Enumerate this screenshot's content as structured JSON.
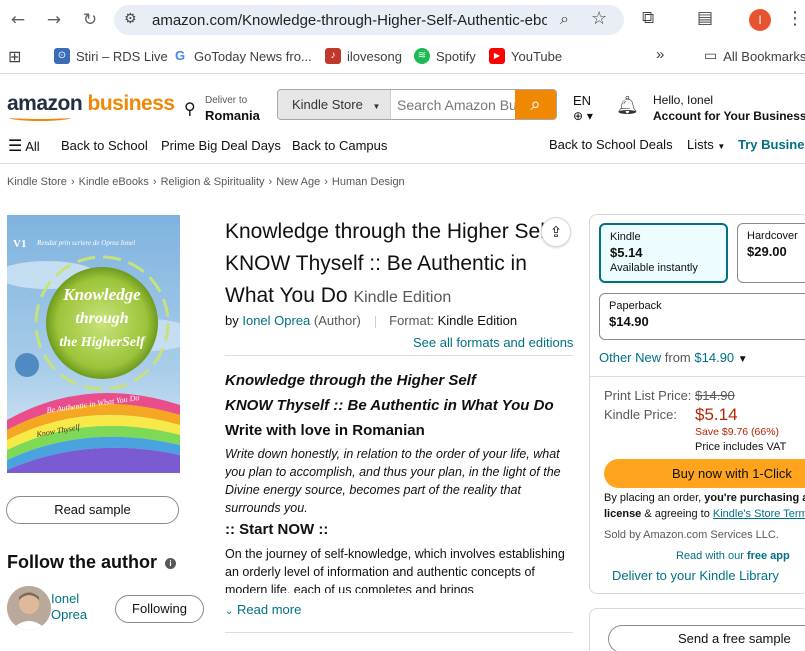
{
  "browser": {
    "url": "amazon.com/Knowledge-through-Higher-Self-Authentic-ebo...",
    "profile_initial": "I",
    "bookmarks": [
      {
        "label": "Stiri – RDS Live",
        "color": "#3b6cb7"
      },
      {
        "label": "GoToday News fro...",
        "color": "#4285f4"
      },
      {
        "label": "ilovesong",
        "color": "#c0392b"
      },
      {
        "label": "Spotify",
        "color": "#1db954"
      },
      {
        "label": "YouTube",
        "color": "#ff0000"
      }
    ],
    "all_bookmarks": "All Bookmarks"
  },
  "header": {
    "logo_amazon": "amazon",
    "logo_business": "business",
    "deliver_to_label": "Deliver to",
    "deliver_to_location": "Romania",
    "search_department": "Kindle Store",
    "search_placeholder": "Search Amazon Bu",
    "language": "EN",
    "greeting": "Hello, Ionel",
    "account_label": "Account for Your Business"
  },
  "subnav": {
    "all": "All",
    "items": [
      "Back to School",
      "Prime Big Deal Days",
      "Back to Campus"
    ],
    "right_items": [
      "Back to School Deals",
      "Lists",
      "Try Busines"
    ]
  },
  "breadcrumbs": [
    "Kindle Store",
    "Kindle eBooks",
    "Religion & Spirituality",
    "New Age",
    "Human Design"
  ],
  "cover": {
    "top_left": "V1",
    "top_text": "Rendat prin scriere de  Oprea Ionel",
    "circle_line1": "Knowledge",
    "circle_line2": "through",
    "circle_line3": "the HigherSelf",
    "bottom_text": "Be Authentic in What You Do",
    "bottom_text2": "Know Thyself"
  },
  "left": {
    "read_sample": "Read sample",
    "follow_author": "Follow the author",
    "author_first": "Ionel",
    "author_last": "Oprea",
    "following": "Following"
  },
  "product": {
    "title": "Knowledge through the Higher Self: KNOW Thyself :: Be Authentic in What You Do",
    "edition": "Kindle Edition",
    "by": "by",
    "author": "Ionel Oprea",
    "author_role": "(Author)",
    "format_label": "Format:",
    "format_value": "Kindle Edition",
    "see_all": "See all formats and editions"
  },
  "description": {
    "heading1": "Knowledge through the Higher Self",
    "heading2": "KNOW Thyself :: Be Authentic in What You Do",
    "heading3": "Write with love in Romanian",
    "italic_para": "Write down honestly, in relation to the order of your life, what you plan to accomplish, and thus your plan, in the light of the Divine energy source, becomes part of the reality that surrounds you.",
    "start_now": ":: Start NOW ::",
    "para": "On the journey of self-knowledge, which involves establishing an orderly level of information and authentic concepts of modern life, each of us completes and brings",
    "read_more": "Read more"
  },
  "buybox": {
    "formats": [
      {
        "name": "Kindle",
        "price": "$5.14",
        "sub": "Available instantly",
        "selected": true
      },
      {
        "name": "Hardcover",
        "price": "$29.00",
        "sub": "",
        "selected": false
      },
      {
        "name": "Paperback",
        "price": "$14.90",
        "sub": "",
        "selected": false
      }
    ],
    "other_new_label": "Other New",
    "other_new_from": "from",
    "other_new_price": "$14.90",
    "print_list_label": "Print List Price:",
    "print_list_price": "$14.90",
    "kindle_price_label": "Kindle Price:",
    "kindle_price": "$5.14",
    "save": "Save $9.76 (66%)",
    "vat": "Price includes VAT",
    "buy_now": "Buy now with 1-Click",
    "placing_order_1": "By placing an order,",
    "placing_order_2": "you're purchasing a",
    "license": "license",
    "agreeing": "& agreeing to",
    "store_terms": "Kindle's Store Term",
    "sold_by": "Sold by Amazon.com Services LLC.",
    "read_with": "Read with our",
    "free_app": "free app",
    "deliver_library": "Deliver to your Kindle Library",
    "send_sample": "Send a free sample"
  }
}
